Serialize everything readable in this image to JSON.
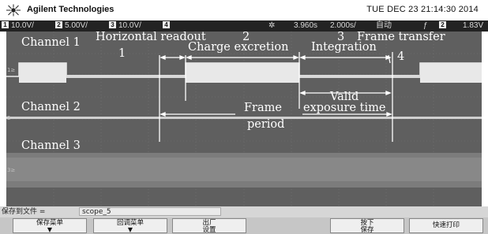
{
  "header": {
    "brand": "Agilent Technologies",
    "datetime": "TUE DEC 23 21:14:30 2014"
  },
  "status": {
    "ch1": {
      "num": "1",
      "scale": "10.0V/"
    },
    "ch2": {
      "num": "2",
      "scale": "5.00V/"
    },
    "ch3": {
      "num": "3",
      "scale": "10.0V/"
    },
    "ch4": {
      "num": "4"
    },
    "delay": "3.960s",
    "timebase": "2.000s/",
    "trigger_mode": "自动",
    "trigger_ch": "2",
    "trigger_level": "1.83V"
  },
  "screen": {
    "channel_1": "Channel 1",
    "channel_2": "Channel 2",
    "channel_3": "Channel 3",
    "horizontal_readout": "Horizontal readout",
    "num_1": "1",
    "num_2": "2",
    "charge_excretion": "Charge excretion",
    "num_3": "3",
    "frame_transfer": "Frame transfer",
    "integration": "Integration",
    "num_4": "4",
    "valid": "Valid",
    "exposure_time": "exposure time",
    "frame": "Frame",
    "period": "period"
  },
  "bottom": {
    "save_to_file_label": "保存到文件 =",
    "filename": "scope_5",
    "softkeys": {
      "save_menu": "保存菜单",
      "recall_menu": "回调菜单",
      "factory_setup_1": "出厂",
      "factory_setup_2": "设置",
      "press_1": "按下",
      "press_2": "保存",
      "quick_print": "快速打印"
    }
  }
}
